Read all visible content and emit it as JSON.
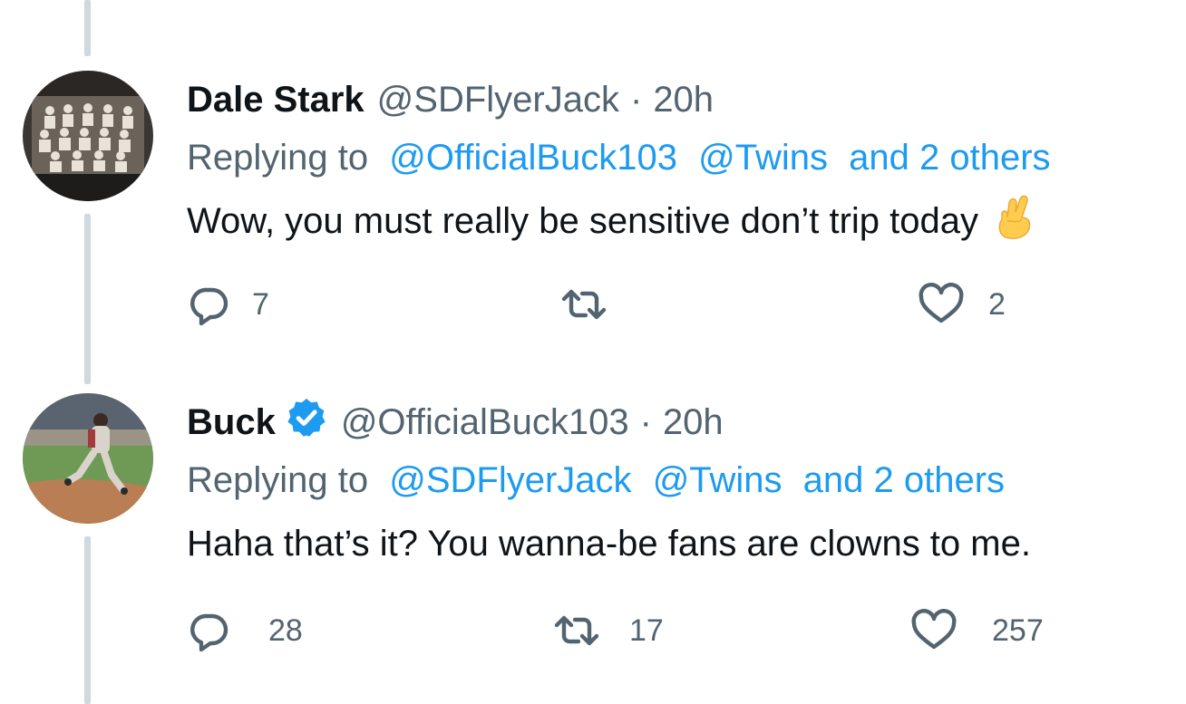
{
  "tweets": [
    {
      "display_name": "Dale Stark",
      "handle": "@SDFlyerJack",
      "separator": "·",
      "time": "20h",
      "verified": false,
      "replying_prefix": "Replying to",
      "replying_links": [
        "@OfficialBuck103",
        "@Twins",
        "and 2 others"
      ],
      "text": "Wow, you must really be sensitive don’t trip today",
      "emoji": "crossed-fingers-icon",
      "reply_count": "7",
      "retweet_count": "",
      "like_count": "2"
    },
    {
      "display_name": "Buck",
      "handle": "@OfficialBuck103",
      "separator": "·",
      "time": "20h",
      "verified": true,
      "replying_prefix": "Replying to",
      "replying_links": [
        "@SDFlyerJack",
        "@Twins",
        "and 2 others"
      ],
      "text": "Haha that’s it? You wanna-be fans are clowns to me.",
      "reply_count": "28",
      "retweet_count": "17",
      "like_count": "257"
    }
  ],
  "colors": {
    "link": "#1d9bf0",
    "secondary": "#536471",
    "text": "#0f1419",
    "thread_line": "#cfd9de",
    "verified": "#1d9bf0"
  },
  "icons": [
    "reply-icon",
    "retweet-icon",
    "like-icon",
    "verified-badge-icon"
  ]
}
